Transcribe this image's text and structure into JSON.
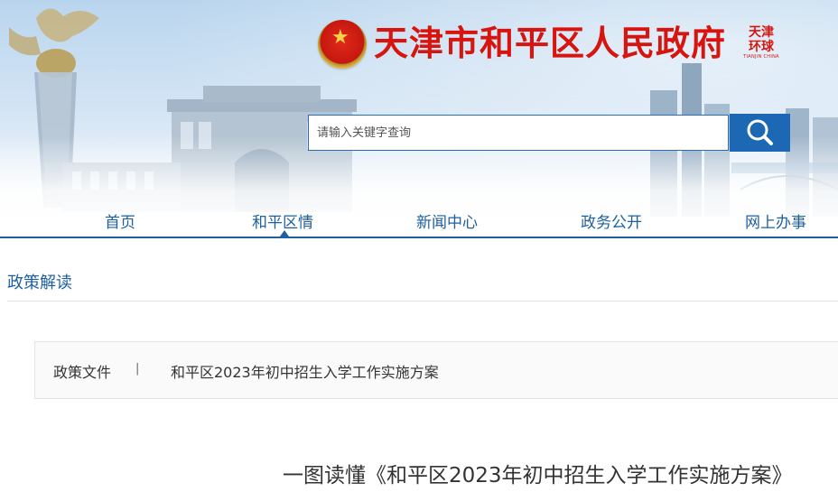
{
  "header": {
    "site_title": "天津市和平区人民政府",
    "seal_text_1": "天津",
    "seal_text_2": "环球",
    "seal_sub": "TIANJIN CHINA"
  },
  "search": {
    "placeholder": "请输入关键字查询",
    "button_icon": "search-icon"
  },
  "nav": {
    "items": [
      "首页",
      "和平区情",
      "新闻中心",
      "政务公开",
      "网上办事"
    ],
    "active_index": 1
  },
  "section": {
    "title": "政策解读"
  },
  "breadcrumb": {
    "category": "政策文件",
    "separator": "|",
    "title": "和平区2023年初中招生入学工作实施方案"
  },
  "article": {
    "title": "一图读懂《和平区2023年初中招生入学工作实施方案》"
  },
  "colors": {
    "accent_blue": "#1e5fa0",
    "title_red": "#d7150e",
    "search_button": "#1c68b4"
  }
}
